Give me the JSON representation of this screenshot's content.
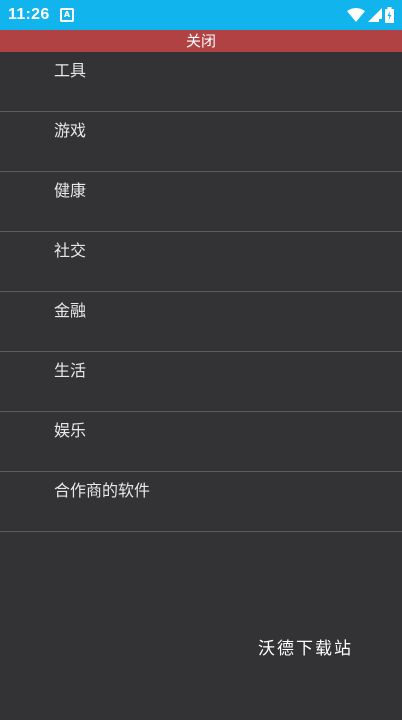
{
  "status_bar": {
    "time": "11:26",
    "app_icon": "A",
    "icons": [
      "wifi-icon",
      "signal-icon",
      "battery-icon"
    ],
    "background": "#12b4ee"
  },
  "close_bar": {
    "label": "关闭",
    "background": "#b04244"
  },
  "menu": {
    "items": [
      {
        "label": "工具"
      },
      {
        "label": "游戏"
      },
      {
        "label": "健康"
      },
      {
        "label": "社交"
      },
      {
        "label": "金融"
      },
      {
        "label": "生活"
      },
      {
        "label": "娱乐"
      },
      {
        "label": "合作商的软件"
      }
    ]
  },
  "watermark": {
    "text": "沃德下载站"
  },
  "colors": {
    "background": "#333234",
    "divider": "#5a595c",
    "text": "#e8e8e8"
  }
}
